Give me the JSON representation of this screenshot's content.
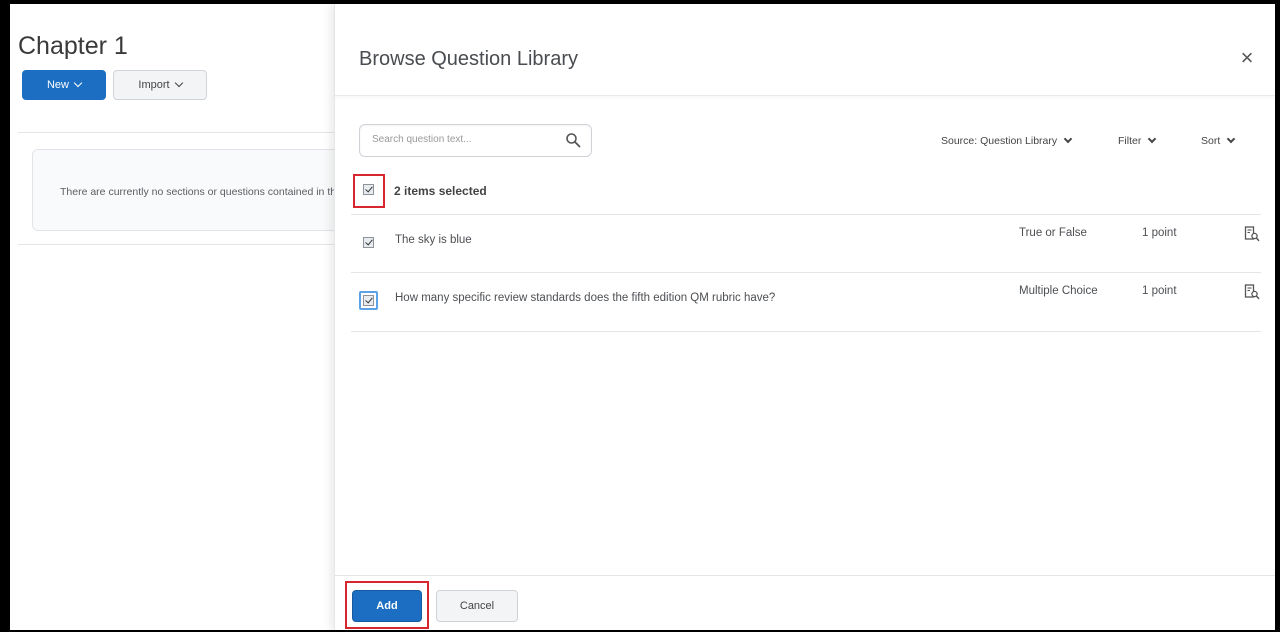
{
  "left_page": {
    "title": "Chapter 1",
    "new_label": "New",
    "import_label": "Import",
    "empty_message": "There are currently no sections or questions contained in this section."
  },
  "dialog": {
    "title": "Browse Question Library",
    "close_icon": "×",
    "search_placeholder": "Search question text...",
    "source_label": "Source: Question Library",
    "filter_label": "Filter",
    "sort_label": "Sort",
    "selected_text": "2 items selected",
    "questions": [
      {
        "text": "The sky is blue",
        "type": "True or False",
        "points": "1 point",
        "checked": true
      },
      {
        "text": "How many specific review standards does the fifth edition QM rubric have?",
        "type": "Multiple Choice",
        "points": "1 point",
        "checked": true
      }
    ],
    "add_label": "Add",
    "cancel_label": "Cancel"
  },
  "colors": {
    "primary": "#1b6ec2",
    "highlight": "#d7262e",
    "focus": "#5ba3e6"
  }
}
